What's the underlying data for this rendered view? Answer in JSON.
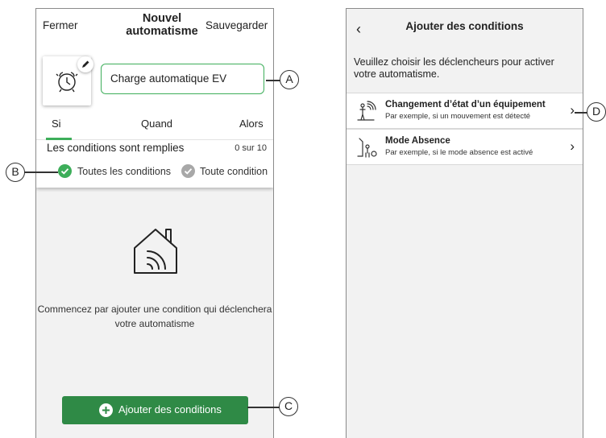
{
  "screen1": {
    "close_label": "Fermer",
    "title_line1": "Nouvel",
    "title_line2": "automatisme",
    "save_label": "Sauvegarder",
    "automation_name": "Charge automatique EV",
    "tabs": [
      {
        "label": "Si"
      },
      {
        "label": "Quand"
      },
      {
        "label": "Alors"
      }
    ],
    "conditions_text": "Les conditions sont remplies",
    "conditions_count": "0 sur 10",
    "option_all": "Toutes les conditions",
    "option_any": "Toute condition",
    "empty_state_text": "Commencez par ajouter une condition qui déclenchera votre automatisme",
    "add_button_label": "Ajouter des conditions"
  },
  "screen2": {
    "title": "Ajouter des conditions",
    "instructions": "Veuillez choisir les déclencheurs pour activer votre automatisme.",
    "options": [
      {
        "title": "Changement d’état d’un équipement",
        "subtitle": "Par exemple, si un mouvement est détecté",
        "icon": "device-state-icon"
      },
      {
        "title": "Mode Absence",
        "subtitle": "Par exemple, si le mode absence est activé",
        "icon": "away-mode-icon"
      }
    ]
  },
  "callouts": {
    "a": "A",
    "b": "B",
    "c": "C",
    "d": "D"
  },
  "colors": {
    "accent": "#3dae5a",
    "button": "#2f8a46",
    "inactive": "#a8a8a8"
  }
}
